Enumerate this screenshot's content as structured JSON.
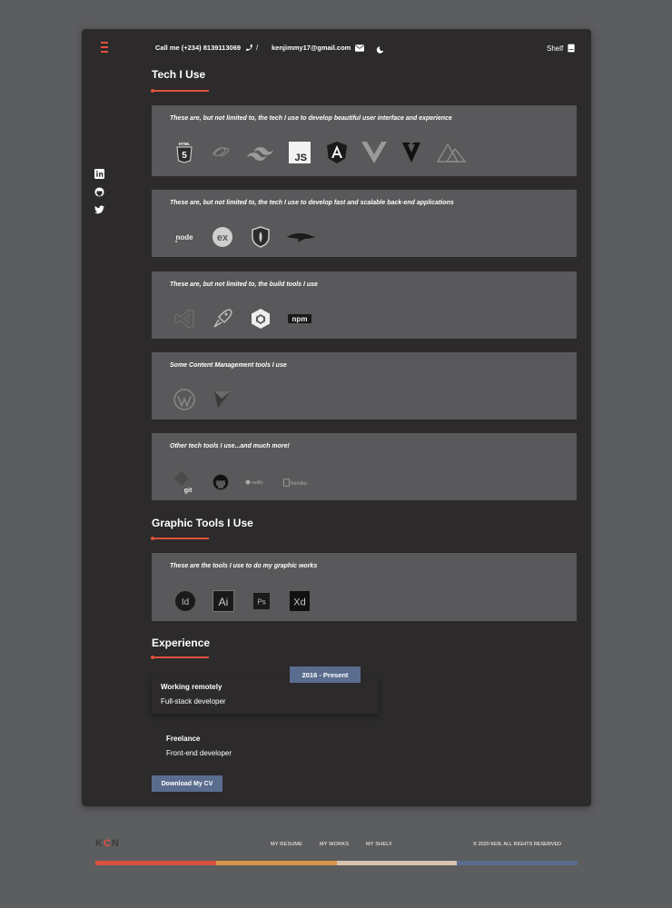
{
  "header": {
    "call_label": "Call me (+234) 8139113069",
    "separator": "/",
    "email": "kenjimmy17@gmail.com",
    "shelf_label": "Shelf"
  },
  "social": [
    "linkedin-icon",
    "github-icon",
    "twitter-icon"
  ],
  "tech": {
    "title": "Tech I Use",
    "panels": [
      {
        "text": "These are, but not limited to, the tech I use to develop beautiful user interface and experience",
        "icons": [
          "html5",
          "sass",
          "tailwind",
          "javascript",
          "angular",
          "vue",
          "vuetify",
          "nuxt"
        ]
      },
      {
        "text": "These are, but not limited to, the tech I use to develop fast and scalable back-end applications",
        "icons": [
          "nodejs",
          "express",
          "mongodb",
          "feathers"
        ]
      },
      {
        "text": "These are, but not limited to, the build tools I use",
        "icons": [
          "vscode",
          "postman",
          "webpack",
          "npm"
        ]
      },
      {
        "text": "Some Content Management tools I use",
        "icons": [
          "wordpress",
          "forestry"
        ]
      },
      {
        "text": "Other tech tools I use...and much more!",
        "icons": [
          "git",
          "github",
          "netlify",
          "heroku"
        ]
      }
    ],
    "icon_text": {
      "html5": "HTML",
      "js": "JS",
      "express": "ex",
      "npm": "npm",
      "git": "git",
      "netlify": "netlify",
      "heroku": "heroku"
    }
  },
  "graphic": {
    "title": "Graphic Tools I Use",
    "panel_text": "These are the tools I use to do my graphic works",
    "icons": [
      {
        "name": "indesign",
        "label": "Id"
      },
      {
        "name": "illustrator",
        "label": "Ai"
      },
      {
        "name": "photoshop",
        "label": "Ps"
      },
      {
        "name": "xd",
        "label": "Xd"
      }
    ]
  },
  "experience": {
    "title": "Experience",
    "badge": "2016 - Present",
    "items": [
      {
        "title": "Working remotely",
        "role": "Full-stack developer"
      },
      {
        "title": "Freelance",
        "role": "Front-end developer"
      }
    ],
    "cv_button": "Download My CV"
  },
  "footer": {
    "logo_k": "K",
    "logo_c": "C",
    "logo_n": "N",
    "links": [
      "MY RESUME",
      "MY WORKS",
      "MY SHELF"
    ],
    "copyright": "© 2020 KEN. ALL RIGHTS RESERVED",
    "bar_colors": [
      "#d9523f",
      "#d9954a",
      "#d8c4b0",
      "#5a6d8f"
    ]
  },
  "colors": {
    "accent": "#e0523e",
    "button": "#5a6d8f",
    "panel": "#59585a",
    "card": "#2c2a2b"
  }
}
